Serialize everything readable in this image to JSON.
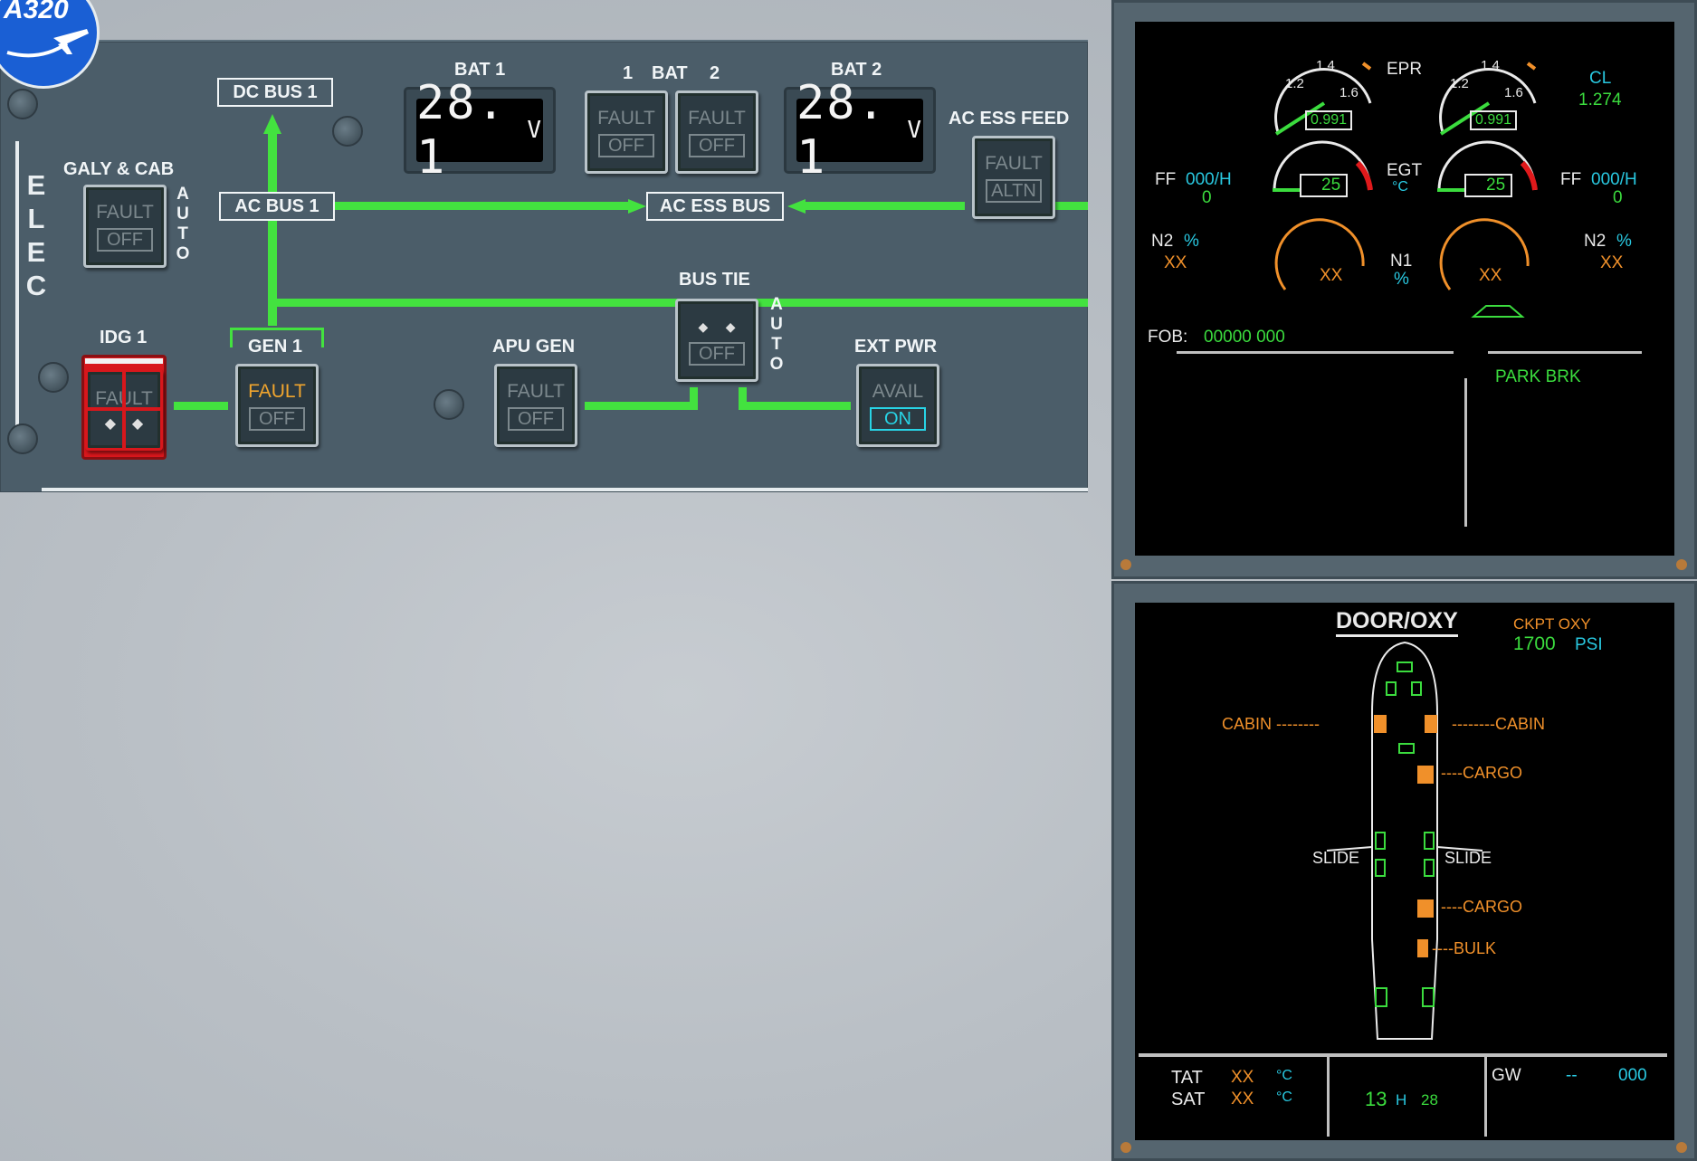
{
  "logo": {
    "text": "A320"
  },
  "elec": {
    "panel_title": "ELEC",
    "galy_cab": {
      "label": "GALY & CAB",
      "top": "FAULT",
      "bottom": "OFF"
    },
    "auto": "AUTO",
    "dc_bus_1": "DC BUS 1",
    "ac_bus_1": "AC BUS 1",
    "ac_ess_bus": "AC ESS BUS",
    "bat1": {
      "label": "BAT 1",
      "value": "28. 1",
      "unit": "V"
    },
    "bat2": {
      "label": "BAT 2",
      "value": "28. 1",
      "unit": "V"
    },
    "bat_pb": {
      "label_1": "1",
      "label_mid": "BAT",
      "label_2": "2",
      "top": "FAULT",
      "bottom": "OFF"
    },
    "ac_ess_feed": {
      "label": "AC ESS FEED",
      "top": "FAULT",
      "bottom": "ALTN"
    },
    "idg1": {
      "label": "IDG 1",
      "top": "FAULT"
    },
    "gen1": {
      "label": "GEN 1",
      "top": "FAULT",
      "bottom": "OFF"
    },
    "apu_gen": {
      "label": "APU GEN",
      "top": "FAULT",
      "bottom": "OFF"
    },
    "bus_tie": {
      "label": "BUS TIE",
      "bottom": "OFF"
    },
    "ext_pwr": {
      "label": "EXT PWR",
      "top": "AVAIL",
      "bottom": "ON"
    }
  },
  "ewd": {
    "epr_label": "EPR",
    "epr_ticks": [
      "1.2",
      "1.4",
      "1.6"
    ],
    "epr_left": "0.991",
    "epr_right": "0.991",
    "cl_label": "CL",
    "cl_value": "1.274",
    "ff_label": "FF",
    "ff_unit": "000/H",
    "ff_left": "0",
    "ff_right": "0",
    "egt_label": "EGT",
    "egt_unit": "°C",
    "egt_left": "25",
    "egt_right": "25",
    "n2_label": "N2",
    "n2_unit": "%",
    "n1_label": "N1",
    "n1_unit": "%",
    "xx": "XX",
    "fob_label": "FOB:",
    "fob_value": "00000 000",
    "park_brk": "PARK BRK"
  },
  "sd": {
    "title": "DOOR/OXY",
    "ckpt_oxy_label": "CKPT OXY",
    "ckpt_oxy_value": "1700",
    "ckpt_oxy_unit": "PSI",
    "cabin_left": "CABIN --------",
    "cabin_right": "--------CABIN",
    "cargo_fwd": "----CARGO",
    "slide_left": "SLIDE",
    "slide_right": "SLIDE",
    "cargo_aft": "----CARGO",
    "bulk": "----BULK",
    "tat_label": "TAT",
    "sat_label": "SAT",
    "tat_value": "XX",
    "sat_value": "XX",
    "temp_unit": "°C",
    "time_h": "13",
    "time_h_label": "H",
    "time_m": "28",
    "gw_label": "GW",
    "gw_dash": "--",
    "gw_value": "000"
  },
  "colors": {
    "bus_green": "#43e23f",
    "ecam_cyan": "#29c8e0",
    "ecam_amber": "#f0902a",
    "idg_red": "#d8171c"
  }
}
